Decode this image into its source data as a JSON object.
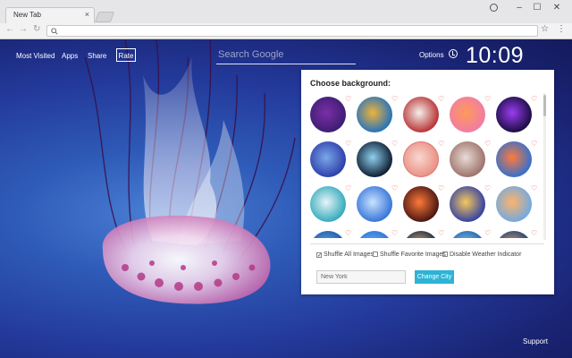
{
  "browser": {
    "tab_title": "New Tab",
    "tab_close": "×",
    "window_controls": [
      "–",
      "☐",
      "✕"
    ],
    "nav": {
      "back": "←",
      "forward": "→",
      "reload": "↻"
    },
    "omnibox_icon": "search-icon",
    "star": "☆",
    "menu": "⋮"
  },
  "topnav": {
    "most_visited": "Most Visited",
    "apps": "Apps",
    "share": "Share",
    "rate": "Rate"
  },
  "search": {
    "placeholder": "Search Google"
  },
  "options_label": "Options",
  "time": "10:09",
  "support_label": "Support",
  "panel": {
    "title": "Choose background:",
    "heart": "♡",
    "thumbs": [
      {
        "c1": "#7a2fa8",
        "c2": "#3a1c6e"
      },
      {
        "c1": "#f0b33a",
        "c2": "#1a6fc4"
      },
      {
        "c1": "#f5f0e8",
        "c2": "#b3282c"
      },
      {
        "c1": "#ff9a5a",
        "c2": "#f07aa8"
      },
      {
        "c1": "#9b3cf2",
        "c2": "#120a38"
      },
      {
        "c1": "#7aa7e8",
        "c2": "#2a3aa8"
      },
      {
        "c1": "#8fd1f0",
        "c2": "#071428"
      },
      {
        "c1": "#f8d8d0",
        "c2": "#e98a7e"
      },
      {
        "c1": "#e8dcd5",
        "c2": "#9a6c66"
      },
      {
        "c1": "#ff7a3a",
        "c2": "#2a6fd6"
      },
      {
        "c1": "#e8f4f8",
        "c2": "#2aa7b8"
      },
      {
        "c1": "#c9e3ff",
        "c2": "#2f6fd6"
      },
      {
        "c1": "#ff7a3a",
        "c2": "#401010"
      },
      {
        "c1": "#f6c95a",
        "c2": "#2a3aa8"
      },
      {
        "c1": "#ffb36a",
        "c2": "#6aa9e8"
      },
      {
        "c1": "#6ab8f0",
        "c2": "#1a4fa0"
      },
      {
        "c1": "#6ab8f0",
        "c2": "#2a6fd6"
      },
      {
        "c1": "#f0c36a",
        "c2": "#0a1a48"
      },
      {
        "c1": "#9ad0f0",
        "c2": "#1a5aa8"
      },
      {
        "c1": "#f0a86a",
        "c2": "#0a3a78"
      }
    ],
    "checkboxes": [
      {
        "label": "Shuffle All Images",
        "checked": "✓"
      },
      {
        "label": "Shuffle Favorite Images",
        "checked": ""
      },
      {
        "label": "Disable Weather Indicator",
        "checked": ""
      }
    ],
    "city_value": "New York",
    "city_button": "Change City"
  }
}
